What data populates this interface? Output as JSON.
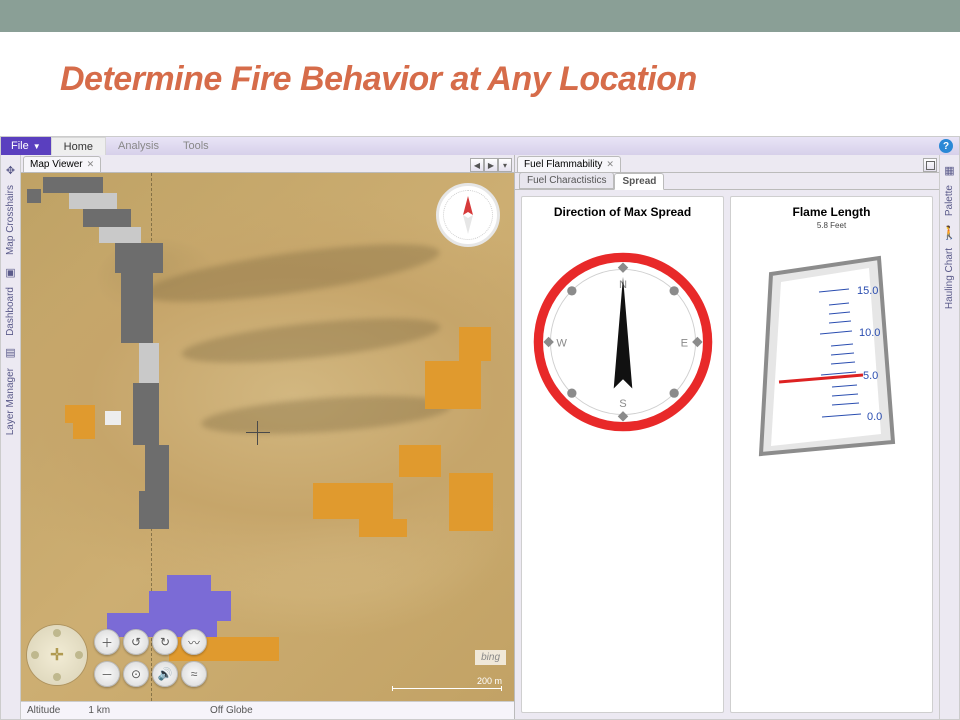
{
  "slide": {
    "title": "Determine Fire Behavior at Any Location"
  },
  "menubar": {
    "file": "File",
    "tabs": [
      {
        "label": "Home",
        "active": true
      },
      {
        "label": "Analysis",
        "active": false
      },
      {
        "label": "Tools",
        "active": false
      }
    ]
  },
  "left_rail": [
    {
      "label": "Map Crosshairs"
    },
    {
      "label": "Dashboard"
    },
    {
      "label": "Layer Manager"
    }
  ],
  "right_rail": [
    {
      "label": "Palette"
    },
    {
      "label": "Hauling Chart"
    }
  ],
  "map_panel": {
    "tab_label": "Map Viewer",
    "attribution": "bing",
    "scale_label": "200 m",
    "footer": {
      "altitude_label": "Altitude",
      "altitude_value": "1 km",
      "globe_status": "Off Globe"
    }
  },
  "flammability_panel": {
    "tab_label": "Fuel Flammability",
    "sub_tabs": [
      {
        "label": "Fuel Charactistics",
        "active": false
      },
      {
        "label": "Spread",
        "active": true
      }
    ],
    "direction_gauge": {
      "title": "Direction of Max Spread",
      "cardinals": {
        "n": "N",
        "e": "E",
        "s": "S",
        "w": "W"
      }
    },
    "flame_gauge": {
      "title": "Flame Length",
      "value_text": "5.8",
      "unit": "Feet",
      "ticks": [
        "15.0",
        "10.0",
        "5.0",
        "0.0"
      ]
    }
  },
  "chart_data": [
    {
      "type": "gauge",
      "subtype": "compass",
      "title": "Direction of Max Spread",
      "value_degrees": 0,
      "cardinals": [
        "N",
        "E",
        "S",
        "W"
      ]
    },
    {
      "type": "gauge",
      "subtype": "linear",
      "title": "Flame Length",
      "value": 5.8,
      "unit": "Feet",
      "range": [
        0.0,
        15.0
      ],
      "ticks": [
        0.0,
        5.0,
        10.0,
        15.0
      ]
    }
  ]
}
